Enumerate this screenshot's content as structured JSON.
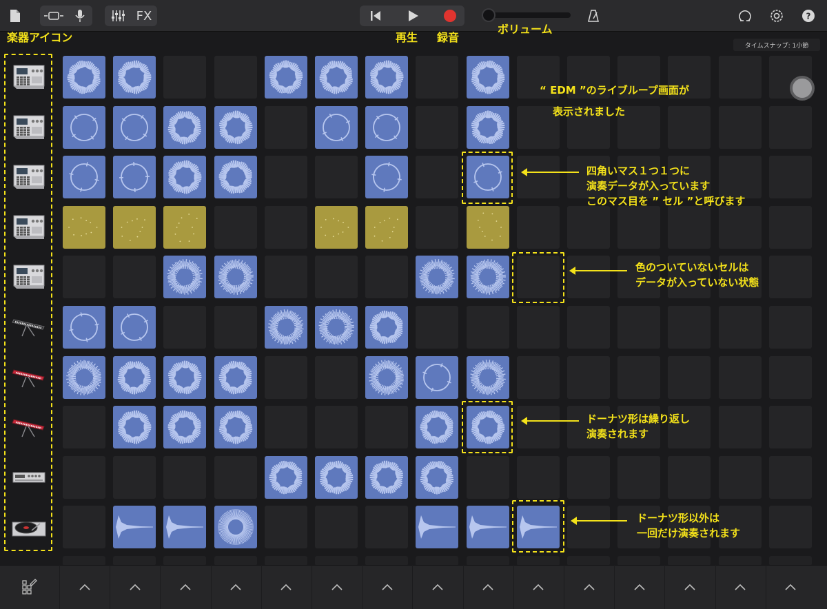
{
  "topbar": {
    "fx_label": "FX",
    "icons": [
      "document-icon",
      "live-loops-view-icon",
      "microphone-icon",
      "mixer-icon",
      "go-to-start-icon",
      "play-icon",
      "record-icon",
      "metronome-icon",
      "loop-browser-icon",
      "settings-icon",
      "help-icon"
    ],
    "time_snap": "タイムスナップ: 1小節"
  },
  "annotations": {
    "instrument_icon": "楽器アイコン",
    "play": "再生",
    "record": "録音",
    "volume": "ボリューム",
    "title_line1": "“ EDM ”のライブループ画面が",
    "title_line2": "表示されました",
    "cell_line1": "四角いマス１つ１つに",
    "cell_line2": "演奏データが入っています",
    "cell_line3": "このマス目を ” セル ”と呼びます",
    "empty_line1": "色のついていないセルは",
    "empty_line2": "データが入っていない状態",
    "donut_line1": "ドーナツ形は繰り返し",
    "donut_line2": "演奏されます",
    "oneshot_line1": "ドーナツ形以外は",
    "oneshot_line2": "一回だけ演奏されます"
  },
  "instruments": [
    "drum-machine",
    "drum-machine",
    "drum-machine",
    "drum-machine",
    "drum-machine",
    "keyboard",
    "keyboard-red",
    "keyboard-red",
    "synth-module",
    "turntable"
  ],
  "grid": {
    "columns": 15,
    "rows": [
      [
        "arrow",
        "arrow",
        "",
        "",
        "ring",
        "ring",
        "ring",
        "",
        "ring",
        "",
        "",
        "",
        "",
        "",
        ""
      ],
      [
        "thin",
        "thin",
        "ring",
        "ring",
        "",
        "thin",
        "thin",
        "",
        "ring",
        "",
        "",
        "",
        "",
        "",
        ""
      ],
      [
        "thin",
        "thin",
        "ring",
        "arrow",
        "",
        "",
        "thin",
        "",
        "thin",
        "",
        "",
        "",
        "",
        "",
        ""
      ],
      [
        "y",
        "y",
        "y",
        "",
        "",
        "y",
        "y",
        "",
        "y",
        "",
        "",
        "",
        "",
        "",
        ""
      ],
      [
        "",
        "",
        "wave",
        "wave",
        "",
        "",
        "",
        "wave",
        "wave",
        "",
        "",
        "",
        "",
        "",
        ""
      ],
      [
        "thin",
        "thin",
        "",
        "",
        "wave",
        "wave",
        "ring",
        "",
        "",
        "",
        "",
        "",
        "",
        "",
        ""
      ],
      [
        "wave",
        "ring",
        "ring",
        "ring",
        "",
        "",
        "wave",
        "thin",
        "wave",
        "",
        "",
        "",
        "",
        "",
        ""
      ],
      [
        "",
        "ring",
        "ring",
        "ring",
        "",
        "",
        "",
        "ring",
        "ring",
        "",
        "",
        "",
        "",
        "",
        ""
      ],
      [
        "",
        "",
        "",
        "",
        "ring",
        "ring",
        "ring",
        "ring",
        "",
        "",
        "",
        "",
        "",
        "",
        ""
      ],
      [
        "",
        "shot",
        "shot",
        "burst",
        "",
        "",
        "",
        "shot",
        "shot",
        "shot",
        "",
        "",
        "",
        "",
        ""
      ]
    ]
  }
}
